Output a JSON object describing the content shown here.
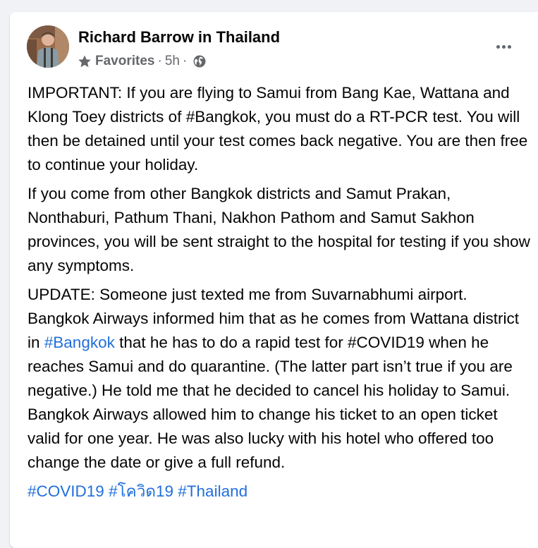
{
  "post": {
    "author": "Richard Barrow in Thailand",
    "audience_label": "Favorites",
    "separator": "·",
    "time": "5h",
    "icons": {
      "audience": "star-icon",
      "privacy": "globe-icon",
      "menu": "more-options-icon"
    },
    "paragraph_1": "IMPORTANT: If you are flying to Samui from Bang Kae, Wattana and Klong Toey districts of #Bangkok, you must do a RT-PCR test. You will then be detained until your test comes back negative. You are then free to continue your holiday.",
    "paragraph_2": "If you come from other Bangkok districts and Samut Prakan, Nonthaburi, Pathum Thani, Nakhon Pathom and Samut Sakhon provinces, you will be sent straight to the hospital for testing if you show any symptoms.",
    "paragraph_3": {
      "before_link": "UPDATE: Someone just texted me from Suvarnabhumi airport. Bangkok Airways informed him that as he comes from Wattana district in ",
      "link": "#Bangkok",
      "after_link": " that he has to do a rapid test for #COVID19 when he reaches Samui and do quarantine. (The latter part isn’t true if you are negative.) He told me that he decided to cancel his holiday to Samui. Bangkok Airways allowed him to change his ticket to an open ticket valid for one year. He was also lucky with his hotel who offered too change the date or give a full refund."
    },
    "hashtags": [
      "#COVID19",
      "#โควิด19",
      "#Thailand"
    ]
  },
  "colors": {
    "background": "#f0f2f5",
    "card": "#ffffff",
    "text_primary": "#050505",
    "text_secondary": "#65676b",
    "link": "#216fdb"
  }
}
